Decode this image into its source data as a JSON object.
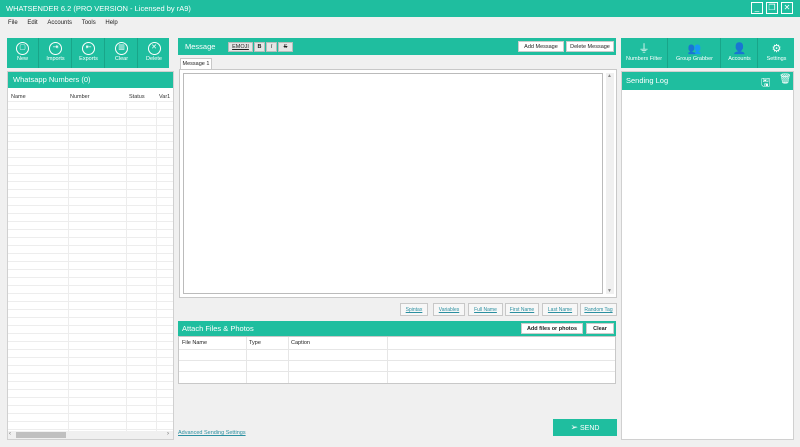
{
  "window": {
    "title": "WHATSENDER 6.2 (PRO VERSION - Licensed by rA9)",
    "minimize": "_",
    "restore": "❐",
    "close": "✕"
  },
  "menu": [
    "File",
    "Edit",
    "Accounts",
    "Tools",
    "Help"
  ],
  "left_toolbar": [
    {
      "label": "New",
      "icon": "file-icon"
    },
    {
      "label": "Imports",
      "icon": "import-icon"
    },
    {
      "label": "Exports",
      "icon": "export-icon"
    },
    {
      "label": "Clear",
      "icon": "trash-icon"
    },
    {
      "label": "Delete",
      "icon": "close-circle-icon"
    }
  ],
  "numbers": {
    "title": "Whatsapp Numbers (0)",
    "columns": [
      "Name",
      "Number",
      "Status",
      "Var1"
    ]
  },
  "message": {
    "title": "Message",
    "format_buttons": [
      "EMOJI",
      "B",
      "I",
      "S"
    ],
    "add_label": "Add Message",
    "delete_label": "Delete Message",
    "tab": "Message 1",
    "content": ""
  },
  "tags": [
    "Spintax",
    "Variables",
    "Full Name",
    "First Name",
    "Last Name",
    "Random Tag"
  ],
  "attach": {
    "title": "Attach Files & Photos",
    "add_label": "Add files or photos",
    "clear_label": "Clear",
    "columns": [
      "File Name",
      "Type",
      "Caption"
    ]
  },
  "advanced_link": "Advanced Sending Settings",
  "send_label": "SEND",
  "right_toolbar": [
    {
      "label": "Numbers Filter",
      "icon": "filter-icon"
    },
    {
      "label": "Group Grabber",
      "icon": "group-icon"
    },
    {
      "label": "Accounts",
      "icon": "account-add-icon"
    },
    {
      "label": "Settings",
      "icon": "gear-icon"
    }
  ],
  "log": {
    "title": "Sending Log"
  },
  "colors": {
    "accent": "#1fbe9f",
    "link": "#2a8fa0"
  }
}
